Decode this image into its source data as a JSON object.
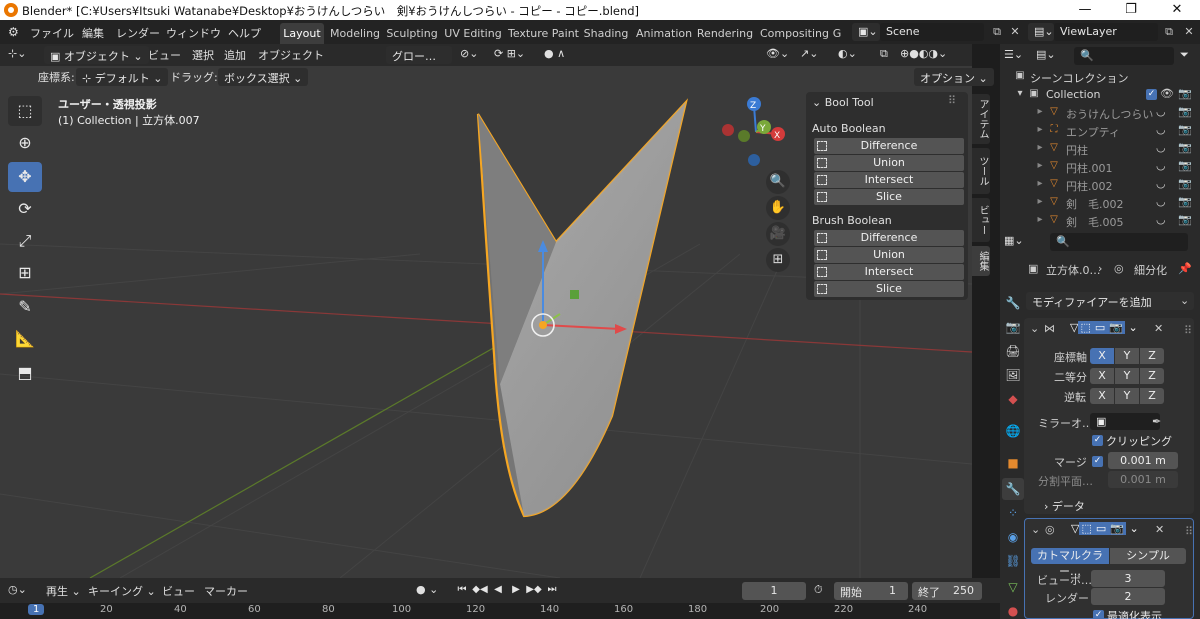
{
  "window": {
    "title": "Blender* [C:¥Users¥Itsuki Watanabe¥Desktop¥おうけんしつらい　剣¥おうけんしつらい - コピー - コピー.blend]",
    "min": "—",
    "max": "❐",
    "close": "✕"
  },
  "menu": [
    "ファイル",
    "編集",
    "レンダー",
    "ウィンドウ",
    "ヘルプ"
  ],
  "workspaces": [
    "Layout",
    "Modeling",
    "Sculpting",
    "UV Editing",
    "Texture Paint",
    "Shading",
    "Animation",
    "Rendering",
    "Compositing",
    "G"
  ],
  "scene": "Scene",
  "viewlayer": "ViewLayer",
  "vp_header": {
    "mode": "オブジェクト",
    "menus": [
      "ビュー",
      "選択",
      "追加",
      "オブジェクト"
    ],
    "orientation": "グロー…",
    "coord_label": "座標系:",
    "coord_value": "デフォルト",
    "drag_label": "ドラッグ:",
    "drag_value": "ボックス選択",
    "options": "オプション"
  },
  "vp_info": {
    "line1": "ユーザー・透視投影",
    "line2": "(1) Collection | 立方体.007"
  },
  "boolpanel": {
    "title": "Bool Tool",
    "auto_heading": "Auto Boolean",
    "auto_items": [
      "Difference",
      "Union",
      "Intersect",
      "Slice"
    ],
    "brush_heading": "Brush Boolean",
    "brush_items": [
      "Difference",
      "Union",
      "Intersect",
      "Slice"
    ]
  },
  "side_tabs": [
    "アイテム",
    "ツール",
    "ビュー",
    "編集"
  ],
  "gizmo": {
    "x": "X",
    "y": "Y",
    "z": "Z"
  },
  "outliner": {
    "scene_collection": "シーンコレクション",
    "collection": "Collection",
    "items": [
      "おうけんしつらい",
      "エンプティ",
      "円柱",
      "円柱.001",
      "円柱.002",
      "剣　毛.002",
      "剣　毛.005"
    ]
  },
  "props": {
    "object": "立方体.0…",
    "modifier": "細分化",
    "add_modifier": "モディファイアーを追加",
    "mirror": {
      "axis_label": "座標軸",
      "bisect_label": "二等分",
      "flip_label": "逆転",
      "axes": [
        "X",
        "Y",
        "Z"
      ],
      "mirror_obj_label": "ミラーオ…",
      "clipping": "クリッピング",
      "merge_label": "マージ",
      "merge_value": "0.001 m",
      "split_label": "分割平面…",
      "split_value": "0.001 m",
      "data": "データ"
    },
    "subsurf": {
      "catmull": "カトマルクラー…",
      "simple": "シンプル",
      "viewport_label": "ビューポ…",
      "viewport_value": "3",
      "render_label": "レンダー",
      "render_value": "2",
      "optimal": "最適化表示"
    }
  },
  "timeline": {
    "playback": "再生",
    "keying": "キーイング",
    "view": "ビュー",
    "marker": "マーカー",
    "current_frame": "1",
    "start_label": "開始",
    "start_value": "1",
    "end_label": "終了",
    "end_value": "250",
    "ticks": [
      "1",
      "20",
      "40",
      "60",
      "80",
      "100",
      "120",
      "140",
      "160",
      "180",
      "200",
      "220",
      "240"
    ]
  },
  "colors": {
    "accent": "#4772b3",
    "select_outline": "#f5a623",
    "x_axis": "#d43b3b",
    "y_axis": "#7aa83a",
    "z_axis": "#3b7bd4"
  }
}
